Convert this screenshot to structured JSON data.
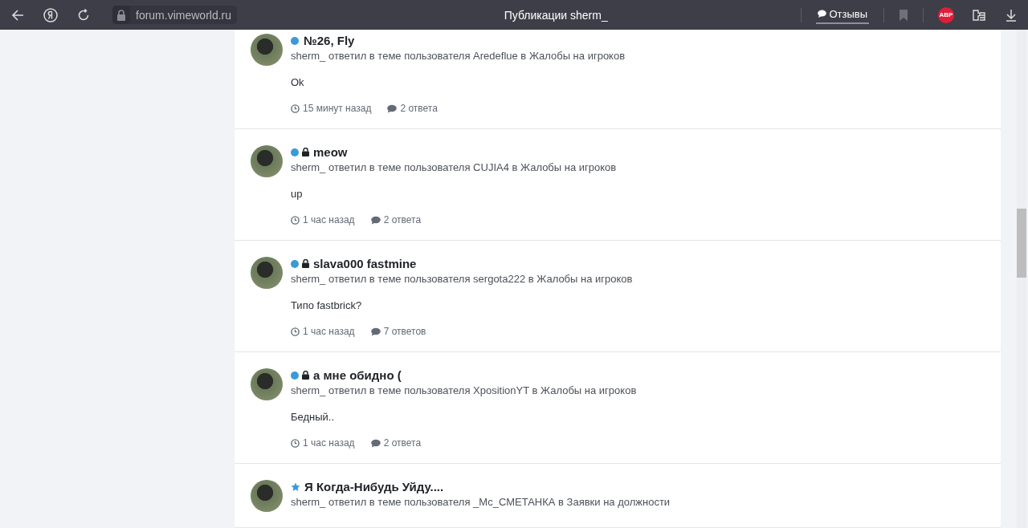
{
  "browser": {
    "url": "forum.vimeworld.ru",
    "title": "Публикации sherm_",
    "feedback": "Отзывы",
    "adblock": "ABP"
  },
  "posts": [
    {
      "marker": {
        "kind": "dot",
        "color": "#3a9ad9"
      },
      "locked": false,
      "title": "№26, Fly",
      "summary": "sherm_ ответил в теме пользователя Aredeflue в Жалобы на игроков",
      "body": "Ok",
      "time": "15 минут назад",
      "replies": "2 ответа"
    },
    {
      "marker": {
        "kind": "dot",
        "color": "#3a9ad9"
      },
      "locked": true,
      "title": "meow",
      "summary": "sherm_ ответил в теме пользователя CUJIA4 в Жалобы на игроков",
      "body": "up",
      "time": "1 час назад",
      "replies": "2 ответа"
    },
    {
      "marker": {
        "kind": "dot",
        "color": "#3a9ad9"
      },
      "locked": true,
      "title": "slava000 fastmine",
      "summary": "sherm_ ответил в теме пользователя sergota222 в Жалобы на игроков",
      "body": "Типо fastbrick?",
      "time": "1 час назад",
      "replies": "7 ответов"
    },
    {
      "marker": {
        "kind": "dot",
        "color": "#3a9ad9"
      },
      "locked": true,
      "title": "а мне обидно (",
      "summary": "sherm_ ответил в теме пользователя XpositionYT в Жалобы на игроков",
      "body": "Бедный..",
      "time": "1 час назад",
      "replies": "2 ответа"
    },
    {
      "marker": {
        "kind": "star",
        "color": "#3a9ad9"
      },
      "locked": false,
      "title": "Я Когда-Нибудь Уйду....",
      "summary": "sherm_ ответил в теме пользователя _Mc_СМЕТАНКА в Заявки на должности"
    }
  ]
}
